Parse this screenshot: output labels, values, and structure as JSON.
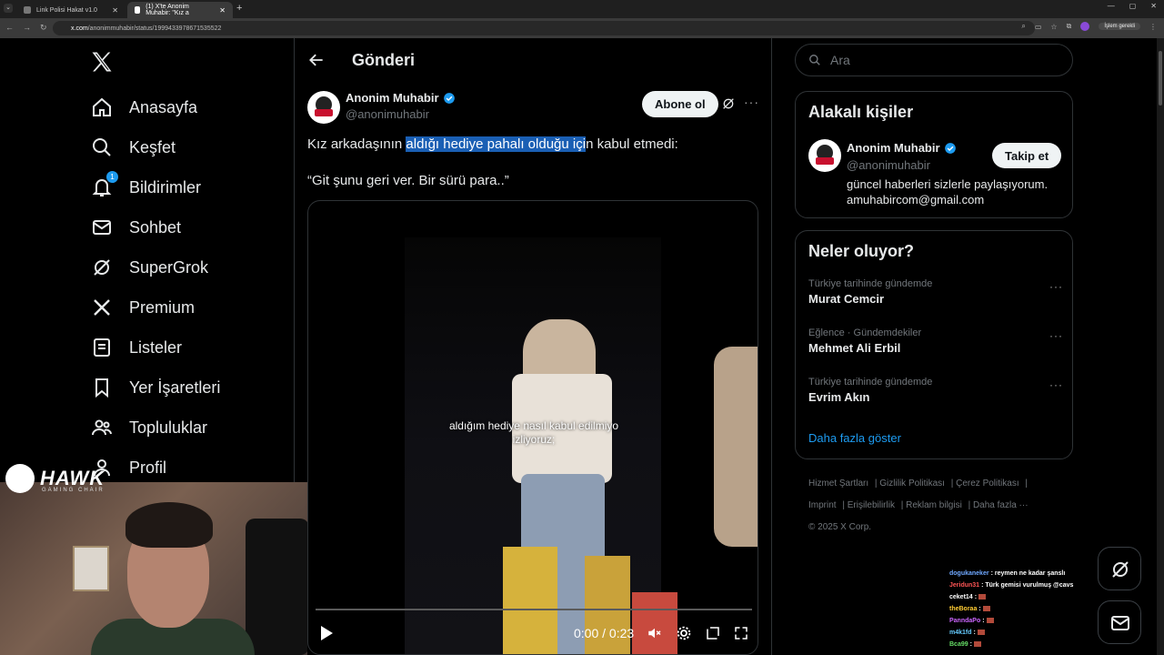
{
  "browser": {
    "tabs": [
      {
        "title": "Link Polisi Hakat v1.0"
      },
      {
        "title": "(1) X'te Anonim Muhabir: \"Kız a"
      }
    ],
    "url_domain": "x.com",
    "url_path": "/anonimmuhabir/status/1999433978671535522",
    "action_button": "İşlem gerekli"
  },
  "nav": {
    "items": [
      {
        "label": "Anasayfa",
        "icon": "home-icon"
      },
      {
        "label": "Keşfet",
        "icon": "search-icon"
      },
      {
        "label": "Bildirimler",
        "icon": "bell-icon",
        "badge": "1"
      },
      {
        "label": "Sohbet",
        "icon": "mail-icon"
      },
      {
        "label": "SuperGrok",
        "icon": "grok-icon"
      },
      {
        "label": "Premium",
        "icon": "x-icon"
      },
      {
        "label": "Listeler",
        "icon": "list-icon"
      },
      {
        "label": "Yer İşaretleri",
        "icon": "bookmark-icon"
      },
      {
        "label": "Topluluklar",
        "icon": "people-icon"
      },
      {
        "label": "Profil",
        "icon": "person-icon"
      }
    ]
  },
  "post": {
    "header_title": "Gönderi",
    "author_name": "Anonim Muhabir",
    "author_handle": "@anonimuhabir",
    "subscribe_label": "Abone ol",
    "text_before": "Kız arkadaşının ",
    "text_highlight": "aldığı hediye pahalı olduğu içi",
    "text_after": "n kabul etmedi:",
    "quote": "“Git şunu geri ver. Bir sürü para..”",
    "video": {
      "subtitle_line1": "aldığım hediye nasıl kabul edilmiyo",
      "subtitle_line2": "izliyoruz;",
      "time": "0:00 / 0:23",
      "progress": 0
    }
  },
  "sidebar": {
    "search_placeholder": "Ara",
    "related": {
      "title": "Alakalı kişiler",
      "name": "Anonim Muhabir",
      "handle": "@anonimuhabir",
      "follow_label": "Takip et",
      "bio_line1": "güncel haberleri sizlerle paylaşıyorum.",
      "bio_line2": "amuhabircom@gmail.com"
    },
    "trends": {
      "title": "Neler oluyor?",
      "items": [
        {
          "context": "Türkiye tarihinde gündemde",
          "topic": "Murat Cemcir"
        },
        {
          "context": "Eğlence · Gündemdekiler",
          "topic": "Mehmet Ali Erbil"
        },
        {
          "context": "Türkiye tarihinde gündemde",
          "topic": "Evrim Akın"
        }
      ],
      "show_more": "Daha fazla göster"
    },
    "footer": {
      "links": [
        "Hizmet Şartları",
        "Gizlilik Politikası",
        "Çerez Politikası",
        "Imprint",
        "Erişilebilirlik",
        "Reklam bilgisi",
        "Daha fazla ···"
      ],
      "copyright": "© 2025 X Corp."
    }
  },
  "chat": [
    {
      "user": "dogukaneker",
      "color": "#6fa8ff",
      "msg": "reymen ne kadar şanslı"
    },
    {
      "user": "Jeridun31",
      "color": "#ff5555",
      "msg": "Türk gemisi vurulmuş @cavs"
    },
    {
      "user": "ceket14",
      "color": "#ffffff",
      "msg": ""
    },
    {
      "user": "theBoraa",
      "color": "#ffcc33",
      "msg": ""
    },
    {
      "user": "PanndaPo",
      "color": "#cc66ff",
      "msg": ""
    },
    {
      "user": "m4k1fd",
      "color": "#66ccff",
      "msg": ""
    },
    {
      "user": "Bca99",
      "color": "#66dd66",
      "msg": ""
    }
  ],
  "overlay": {
    "brand": "HAWK",
    "brand_sub": "GAMING CHAIR"
  },
  "colors": {
    "accent": "#1d9bf0",
    "background": "#000000",
    "border": "#2f3336",
    "highlight": "#1a5fb4"
  }
}
